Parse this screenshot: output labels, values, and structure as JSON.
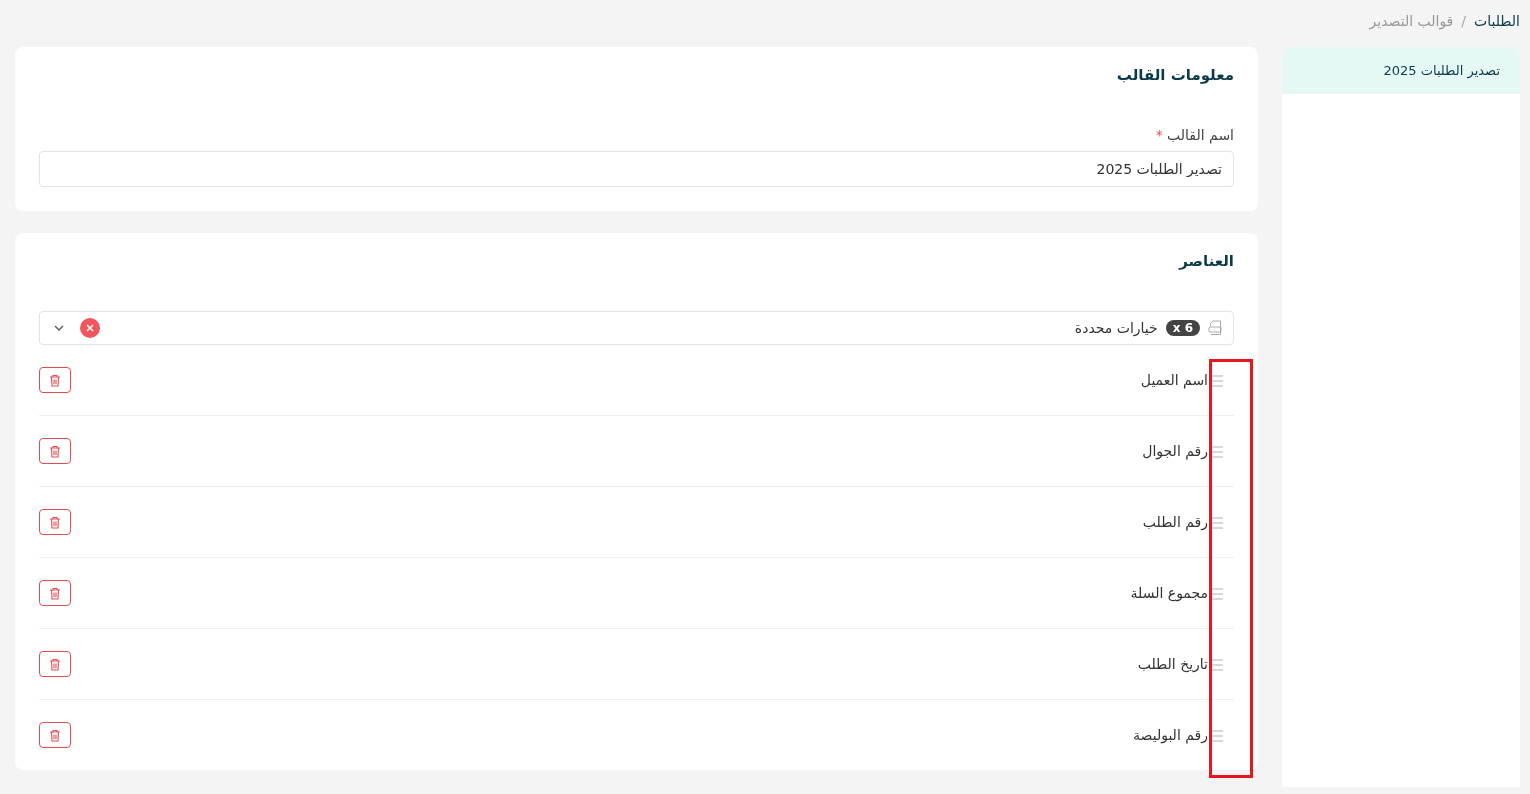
{
  "breadcrumb": [
    {
      "label": "الطلبات",
      "current": false
    },
    {
      "label": "قوالب التصدير",
      "current": true
    }
  ],
  "breadcrumb_separator": "/",
  "sidebar": {
    "items": [
      {
        "label": "تصدير الطلبات 2025",
        "selected": true
      }
    ]
  },
  "template_info": {
    "title": "معلومات القالب",
    "field": {
      "label": "اسم القالب",
      "required_mark": "*",
      "value": "تصدير الطلبات 2025"
    }
  },
  "elements": {
    "title": "العناصر",
    "select": {
      "value": "خيارات محددة",
      "count": "x 6"
    },
    "items": [
      {
        "label": "اسم العميل"
      },
      {
        "label": "رقم الجوال"
      },
      {
        "label": "رقم الطلب"
      },
      {
        "label": "مجموع السلة"
      },
      {
        "label": "تاريخ الطلب"
      },
      {
        "label": "رقم البوليصة"
      }
    ],
    "handles_highlighted": true
  }
}
